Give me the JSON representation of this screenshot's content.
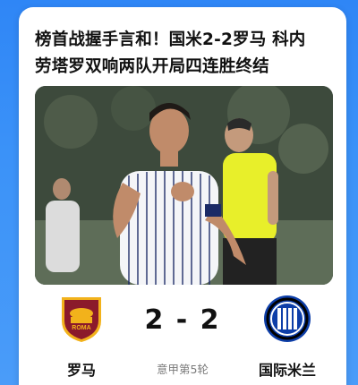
{
  "article": {
    "headline_line1": "榜首战握手言和！国米2-2罗马 科内",
    "headline_line2": "劳塔罗双响两队开局四连胜终结"
  },
  "match": {
    "home_team": "罗马",
    "away_team": "国际米兰",
    "score": "2 - 2",
    "round": "意甲第5轮"
  },
  "colors": {
    "background": "#3b8ff7",
    "card": "#ffffff",
    "roma_red": "#8b1a2b",
    "roma_gold": "#f2b21b",
    "inter_blue": "#0d3ea8"
  },
  "icons": {
    "home_logo": "roma-crest-icon",
    "away_logo": "inter-crest-icon"
  }
}
